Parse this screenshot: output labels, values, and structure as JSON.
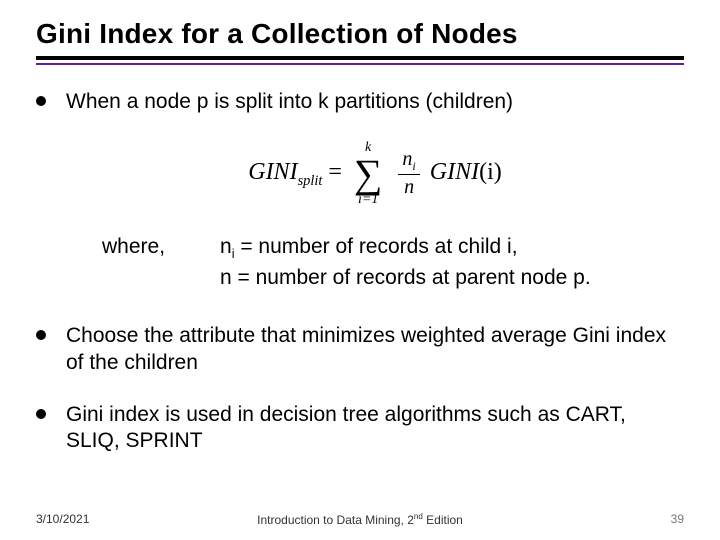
{
  "title": "Gini Index for a Collection of Nodes",
  "bullets": {
    "b1": "When a node p is split into k partitions (children)",
    "b2": "Choose the attribute that minimizes weighted average Gini index of the children",
    "b3": "Gini index is used in decision tree algorithms such as CART, SLIQ, SPRINT"
  },
  "formula": {
    "lhs": "GINI",
    "lhs_sub": "split",
    "eq": "=",
    "sum_top": "k",
    "sum_bot": "i=1",
    "frac_num_n": "n",
    "frac_num_sub": "i",
    "frac_den": "n",
    "rhs_func": "GINI",
    "rhs_arg": "(i)"
  },
  "where": {
    "label": "where,",
    "d1_sym": "n",
    "d1_sub": "i",
    "d1_text": " = number of records at child i,",
    "d2_sym": "n",
    "d2_text": "  = number of records at parent node p."
  },
  "footer": {
    "date": "3/10/2021",
    "center_pre": "Introduction to Data Mining, 2",
    "center_sup": "nd",
    "center_post": " Edition",
    "page": "39"
  }
}
